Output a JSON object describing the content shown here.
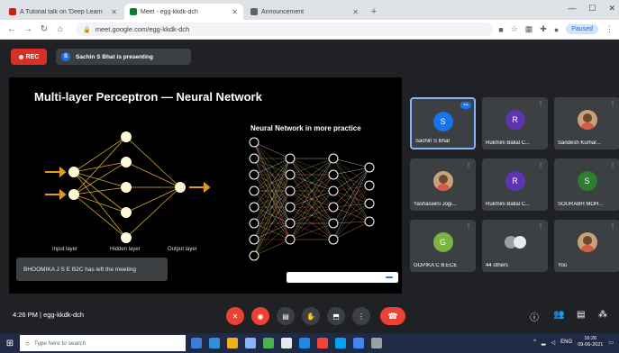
{
  "browser": {
    "tabs": [
      {
        "title": "A Tutorial talk on 'Deep Learn",
        "fav_color": "#c5221f",
        "active": false
      },
      {
        "title": "Meet - egg-kkdk-dch",
        "fav_color": "#00832d",
        "active": true
      },
      {
        "title": "Announcement",
        "fav_color": "#5f6368",
        "active": false
      }
    ],
    "new_tab": "+",
    "url": "meet.google.com/egg-kkdk-dch",
    "profile_status": "Paused"
  },
  "meet": {
    "rec_label": "REC",
    "presenting_initial": "S",
    "presenting_text": "Sachin S Bhat is presenting",
    "meeting_time": "4:26 PM",
    "meeting_code": "egg-kkdk-dch"
  },
  "slide": {
    "title": "Multi-layer Perceptron — Neural Network",
    "subtitle": "Neural Network in more practice",
    "input_label": "Input layer",
    "hidden_label": "Hidden layer",
    "output_label": "Output layer",
    "notice": "BHOOMIKA J S E B2C has left the meeting"
  },
  "participants": [
    {
      "name": "Sachin S Bhat",
      "initial": "S",
      "color": "#1a73e8",
      "type": "initial",
      "speaking": true
    },
    {
      "name": "Rukmini Ballal C...",
      "initial": "R",
      "color": "#5e35b1",
      "type": "initial",
      "speaking": false
    },
    {
      "name": "Sandesh Kumar...",
      "initial": "",
      "color": "#c9a27a",
      "type": "photo",
      "speaking": false
    },
    {
      "name": "Yashaswini Jogi...",
      "initial": "",
      "color": "#c9a27a",
      "type": "photo",
      "speaking": false
    },
    {
      "name": "Rukmini Ballal C...",
      "initial": "R",
      "color": "#5e35b1",
      "type": "initial",
      "speaking": false
    },
    {
      "name": "SOURABH MOH...",
      "initial": "S",
      "color": "#2e7d32",
      "type": "initial",
      "speaking": false
    },
    {
      "name": "GOPIKA C B.ECE",
      "initial": "G",
      "color": "#7cb342",
      "type": "initial",
      "speaking": false
    },
    {
      "name": "44 others",
      "initial": "",
      "color": "#5f6368",
      "type": "others",
      "speaking": false
    },
    {
      "name": "You",
      "initial": "",
      "color": "#c9a27a",
      "type": "photo",
      "speaking": false
    }
  ],
  "taskbar": {
    "search_placeholder": "Type here to search",
    "time": "16:26",
    "date": "09-06-2021",
    "lang": "ENG"
  }
}
